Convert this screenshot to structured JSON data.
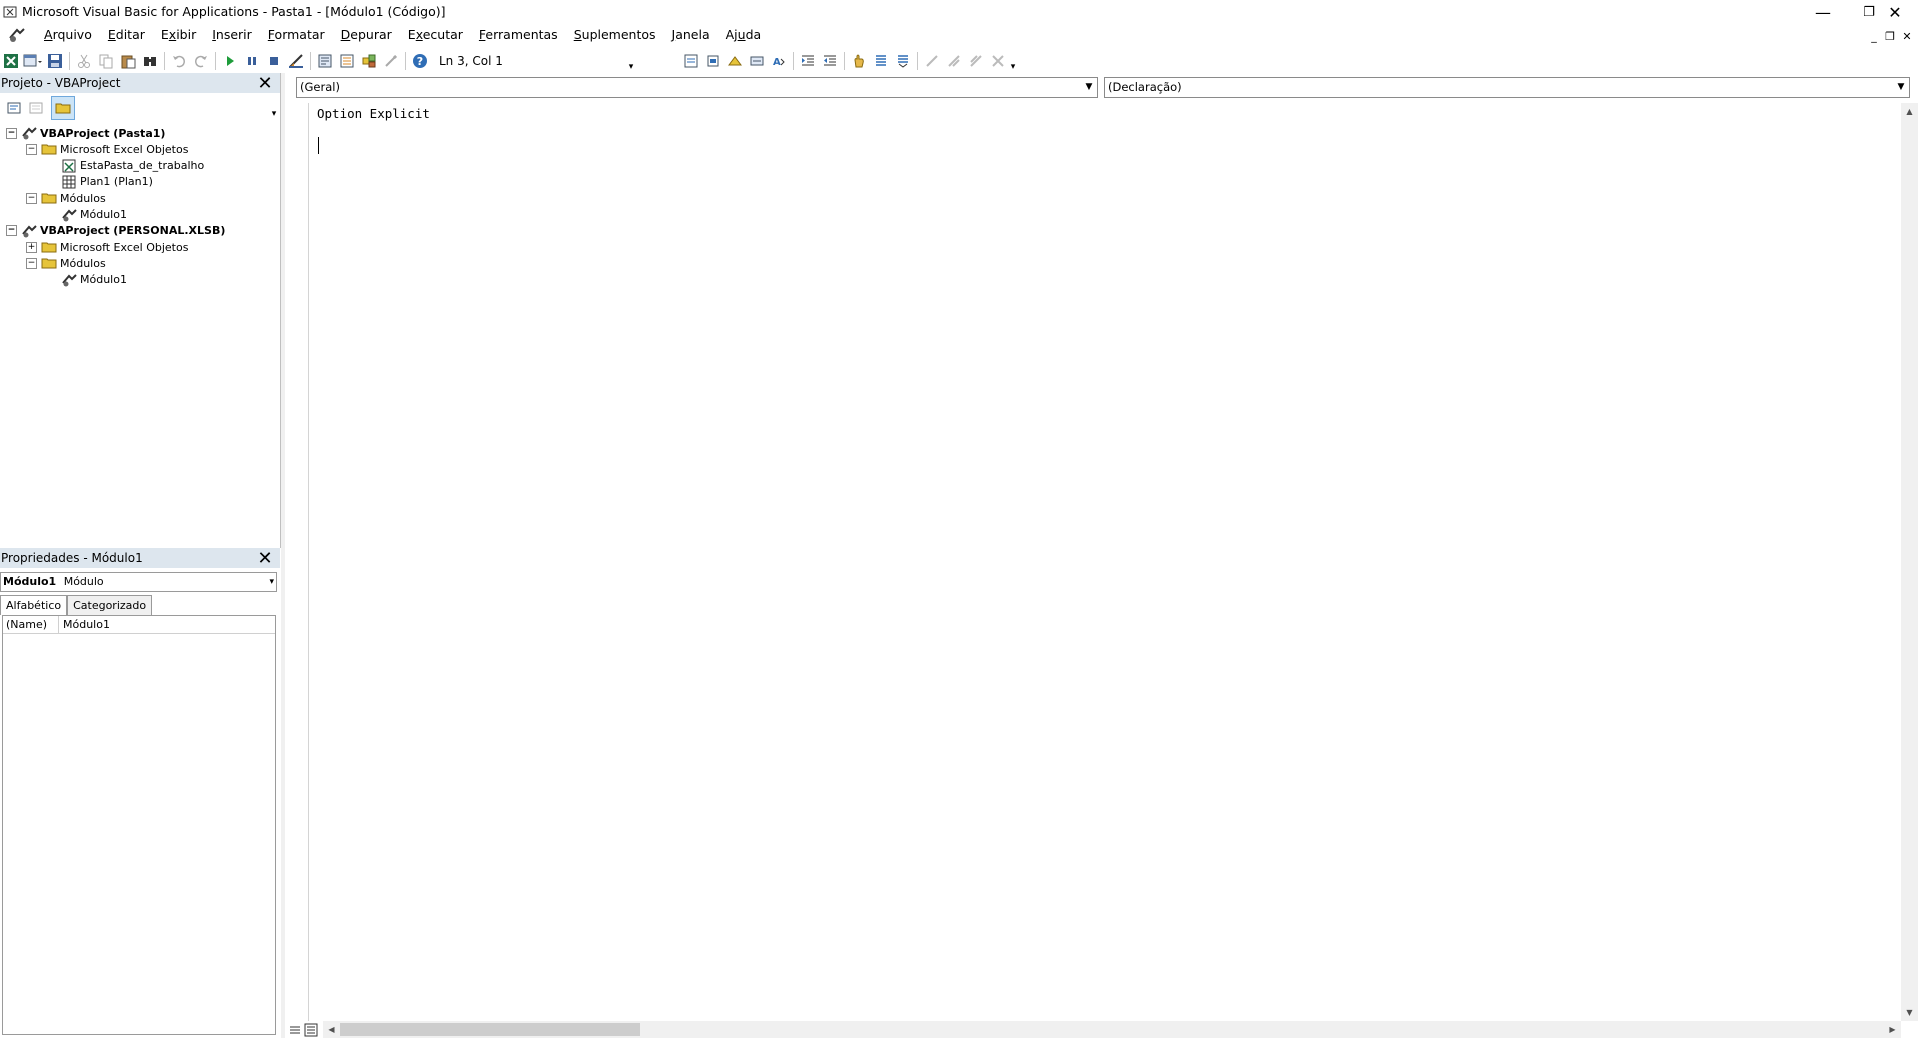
{
  "window": {
    "title": "Microsoft Visual Basic for Applications - Pasta1 - [Módulo1 (Código)]",
    "controls": {
      "minimize": "—",
      "restore": "❐",
      "close": "✕"
    }
  },
  "menubar": {
    "items": [
      {
        "pre": "",
        "u": "A",
        "post": "rquivo"
      },
      {
        "pre": "",
        "u": "E",
        "post": "ditar"
      },
      {
        "pre": "E",
        "u": "x",
        "post": "ibir"
      },
      {
        "pre": "",
        "u": "I",
        "post": "nserir"
      },
      {
        "pre": "",
        "u": "F",
        "post": "ormatar"
      },
      {
        "pre": "",
        "u": "D",
        "post": "epurar"
      },
      {
        "pre": "E",
        "u": "x",
        "post": "ecutar"
      },
      {
        "pre": "",
        "u": "F",
        "post": "erramentas"
      },
      {
        "pre": "",
        "u": "S",
        "post": "uplementos"
      },
      {
        "pre": "",
        "u": "J",
        "post": "anela"
      },
      {
        "pre": "Aj",
        "u": "u",
        "post": "da"
      }
    ],
    "mdi_controls": {
      "minimize": "_",
      "restore": "❐",
      "close": "✕"
    }
  },
  "toolbar": {
    "position": "Ln 3, Col 1",
    "icons": [
      "excel-icon",
      "insert-userform-icon",
      "save-icon",
      "cut-icon",
      "copy-icon",
      "paste-icon",
      "find-icon",
      "undo-icon",
      "redo-icon",
      "run-icon",
      "break-icon",
      "reset-icon",
      "design-mode-icon",
      "project-explorer-icon",
      "properties-icon",
      "object-browser-icon",
      "toolbox-icon",
      "help-icon"
    ]
  },
  "project_panel": {
    "title": "Projeto - VBAProject",
    "tree": [
      {
        "label": "VBAProject (Pasta1)",
        "bold": true,
        "expander": "−",
        "icon": "vbaproject",
        "level": 0
      },
      {
        "label": "Microsoft Excel Objetos",
        "bold": false,
        "expander": "−",
        "icon": "folder",
        "level": 1
      },
      {
        "label": "EstaPasta_de_trabalho",
        "bold": false,
        "expander": "",
        "icon": "workbook",
        "level": 2
      },
      {
        "label": "Plan1 (Plan1)",
        "bold": false,
        "expander": "",
        "icon": "sheet",
        "level": 2
      },
      {
        "label": "Módulos",
        "bold": false,
        "expander": "−",
        "icon": "folder",
        "level": 1
      },
      {
        "label": "Módulo1",
        "bold": false,
        "expander": "",
        "icon": "module",
        "level": 2
      },
      {
        "label": "VBAProject (PERSONAL.XLSB)",
        "bold": true,
        "expander": "−",
        "icon": "vbaproject",
        "level": 0
      },
      {
        "label": "Microsoft Excel Objetos",
        "bold": false,
        "expander": "+",
        "icon": "folder",
        "level": 1
      },
      {
        "label": "Módulos",
        "bold": false,
        "expander": "−",
        "icon": "folder",
        "level": 1
      },
      {
        "label": "Módulo1",
        "bold": false,
        "expander": "",
        "icon": "module",
        "level": 2
      }
    ]
  },
  "properties_panel": {
    "title": "Propriedades - Módulo1",
    "object_name": "Módulo1",
    "object_type": "Módulo",
    "tabs": [
      "Alfabético",
      "Categorizado"
    ],
    "rows": [
      {
        "name": "(Name)",
        "value": "Módulo1"
      }
    ]
  },
  "code_window": {
    "object_combo": "(Geral)",
    "procedure_combo": "(Declaração)",
    "code": "Option Explicit"
  }
}
